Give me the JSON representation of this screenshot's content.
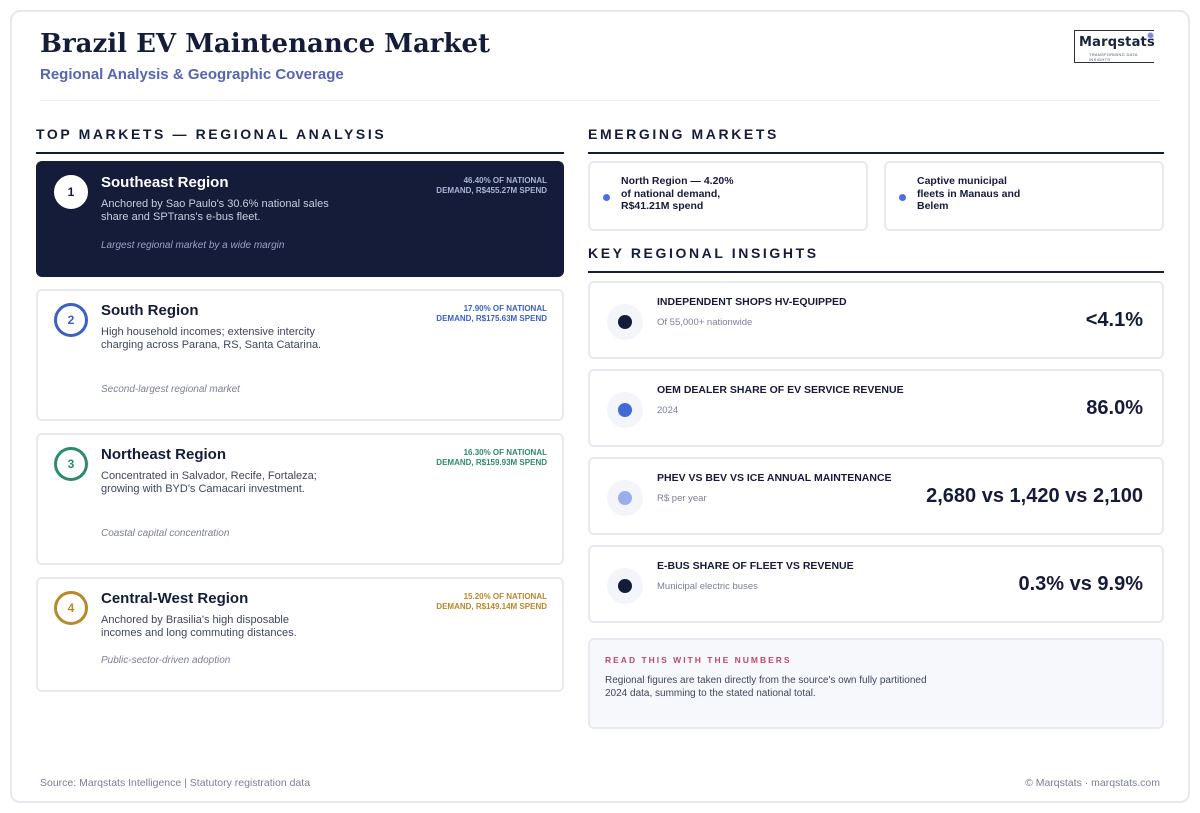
{
  "header": {
    "title": "Brazil EV Maintenance Market",
    "subtitle": "Regional Analysis & Geographic Coverage",
    "logo_word": "Marqstats",
    "logo_tagline": "TRANSFORMING DATA INSIGHTS"
  },
  "top_markets": {
    "section_title": "TOP MARKETS — REGIONAL ANALYSIS",
    "regions": [
      {
        "rank": "1",
        "name": "Southeast Region",
        "description": "Anchored by Sao Paulo's 30.6% national sales share and SPTrans's e-bus fleet.",
        "stat": "46.40% OF NATIONAL DEMAND, R$455.27M SPEND",
        "note": "Largest regional market by a wide margin",
        "accent": "#141c3a"
      },
      {
        "rank": "2",
        "name": "South Region",
        "description": "High household incomes; extensive intercity charging across Parana, RS, Santa Catarina.",
        "stat": "17.90% OF NATIONAL DEMAND, R$175.63M SPEND",
        "note": "Second-largest regional market",
        "accent": "#3b5fc8"
      },
      {
        "rank": "3",
        "name": "Northeast Region",
        "description": "Concentrated in Salvador, Recife, Fortaleza; growing with BYD's Camacari investment.",
        "stat": "16.30% OF NATIONAL DEMAND, R$159.93M SPEND",
        "note": "Coastal capital concentration",
        "accent": "#2e8a6a"
      },
      {
        "rank": "4",
        "name": "Central-West Region",
        "description": "Anchored by Brasilia's high disposable incomes and long commuting distances.",
        "stat": "15.20% OF NATIONAL DEMAND, R$149.14M SPEND",
        "note": "Public-sector-driven adoption",
        "accent": "#b8892a"
      }
    ]
  },
  "emerging_markets": {
    "section_title": "EMERGING MARKETS",
    "items": [
      "North Region — 4.20% of national demand, R$41.21M spend",
      "Captive municipal fleets in Manaus and Belem"
    ]
  },
  "key_insights": {
    "section_title": "KEY REGIONAL INSIGHTS",
    "items": [
      {
        "label": "INDEPENDENT SHOPS HV-EQUIPPED",
        "sub": "Of 55,000+ nationwide",
        "value": "<4.1%",
        "color": "#141c3a"
      },
      {
        "label": "OEM DEALER SHARE OF EV SERVICE REVENUE",
        "sub": "2024",
        "value": "86.0%",
        "color": "#4169d8"
      },
      {
        "label": "PHEV VS BEV VS ICE ANNUAL MAINTENANCE",
        "sub": "R$ per year",
        "value": "2,680 vs 1,420 vs 2,100",
        "color": "#9aaeef"
      },
      {
        "label": "E-BUS SHARE OF FLEET VS REVENUE",
        "sub": "Municipal electric buses",
        "value": "0.3% vs 9.9%",
        "color": "#141c3a"
      }
    ]
  },
  "note": {
    "title": "READ THIS WITH THE NUMBERS",
    "text": "Regional figures are taken directly from the source's own fully partitioned 2024 data, summing to the stated national total."
  },
  "footer": {
    "source": "Source: Marqstats Intelligence | Statutory registration data",
    "copyright": "© Marqstats · marqstats.com"
  }
}
